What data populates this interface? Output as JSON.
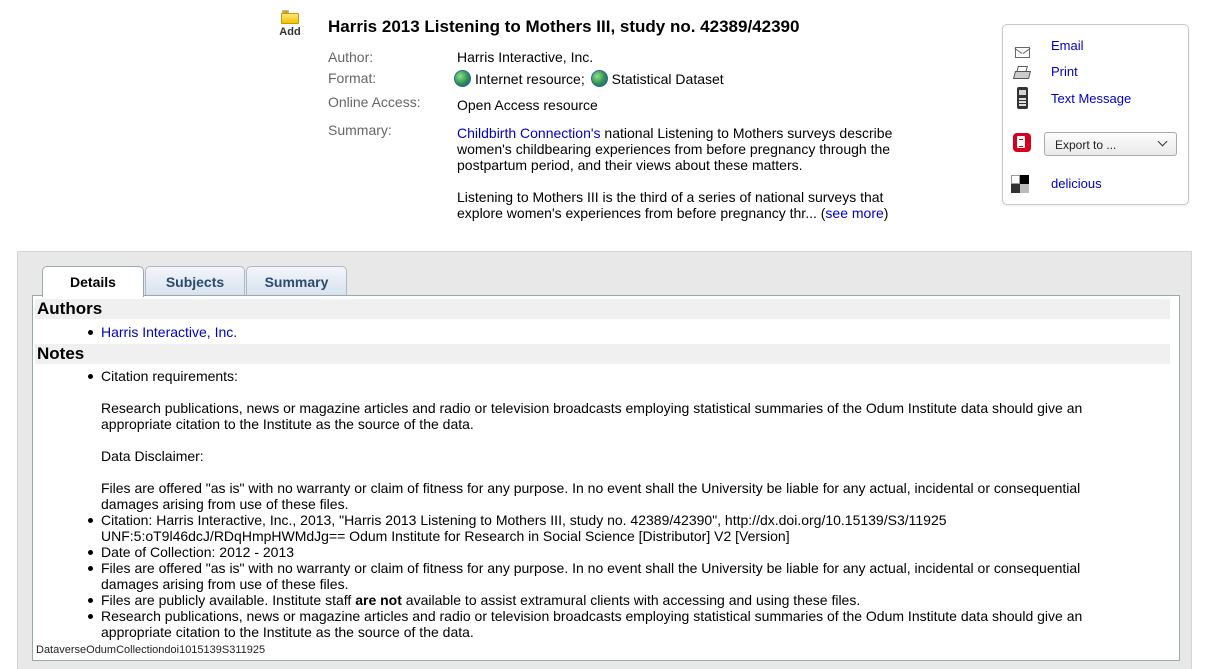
{
  "record": {
    "add_label": "Add",
    "title": "Harris 2013 Listening to Mothers III, study no. 42389/42390",
    "author_label": "Author:",
    "author_value": "Harris Interactive, Inc.",
    "format_label": "Format:",
    "format_items": [
      "Internet resource;",
      "Statistical Dataset"
    ],
    "online_access_label": "Online Access:",
    "online_access_value": "Open Access resource",
    "summary_label": "Summary:",
    "summary_link": "Childbirth Connection's",
    "summary_p1_rest": " national Listening to Mothers surveys describe women's childbearing experiences from before pregnancy through the postpartum period, and their views about these matters.",
    "summary_p2": "Listening to Mothers III is the third of a series of national surveys that explore women's experiences from before pregnancy thr... (",
    "see_more": "see more",
    "summary_p2_end": ")"
  },
  "actions": {
    "email": "Email",
    "print": "Print",
    "text_message": "Text Message",
    "export_placeholder": "Export to ...",
    "delicious": "delicious"
  },
  "tabs": [
    {
      "label": "Details",
      "active": true
    },
    {
      "label": "Subjects",
      "active": false
    },
    {
      "label": "Summary",
      "active": false
    }
  ],
  "details": {
    "authors_heading": "Authors",
    "authors": [
      "Harris Interactive, Inc."
    ],
    "notes_heading": "Notes",
    "note1_p1": "Citation requirements:",
    "note1_p2": "Research publications, news or magazine articles and radio or television broadcasts employing statistical summaries of the Odum Institute data should give an appropriate citation to the Institute as the source of the data.",
    "note1_p3": "Data Disclaimer:",
    "note1_p4": "Files are offered \"as is\" with no warranty or claim of fitness for any purpose. In no event shall the University be liable for any actual, incidental or consequential damages arising from use of these files.",
    "note2": "Citation: Harris Interactive, Inc., 2013, \"Harris 2013 Listening to Mothers III, study no. 42389/42390\", http://dx.doi.org/10.15139/S3/11925 UNF:5:oT9l46dcJ/RDqHmpHWMdJg== Odum Institute for Research in Social Science [Distributor] V2 [Version]",
    "note3": "Date of Collection: 2012 - 2013",
    "note4": "Files are offered \"as is\" with no warranty or claim of fitness for any purpose. In no event shall the University be liable for any actual, incidental or consequential damages arising from use of these files.",
    "note5_a": "Files are publicly available. Institute staff ",
    "note5_bold": "are not",
    "note5_b": " available to assist extramural clients with accessing and using these files.",
    "note6": "Research publications, news or magazine articles and radio or television broadcasts employing statistical summaries of the Odum Institute data should give an appropriate citation to the Institute as the source of the data.",
    "footer_id": "DataverseOdumCollectiondoi1015139S311925"
  },
  "colors": {
    "link": "#0000cc",
    "panel_bg": "#e8e8e8",
    "tab_text": "#2a4a6e",
    "section_bg": "#f0f0f0"
  },
  "icons": [
    "folder-add-icon",
    "globe-icon",
    "email-icon",
    "printer-icon",
    "phone-icon",
    "pdf-export-icon",
    "delicious-icon",
    "chevron-down-icon"
  ]
}
